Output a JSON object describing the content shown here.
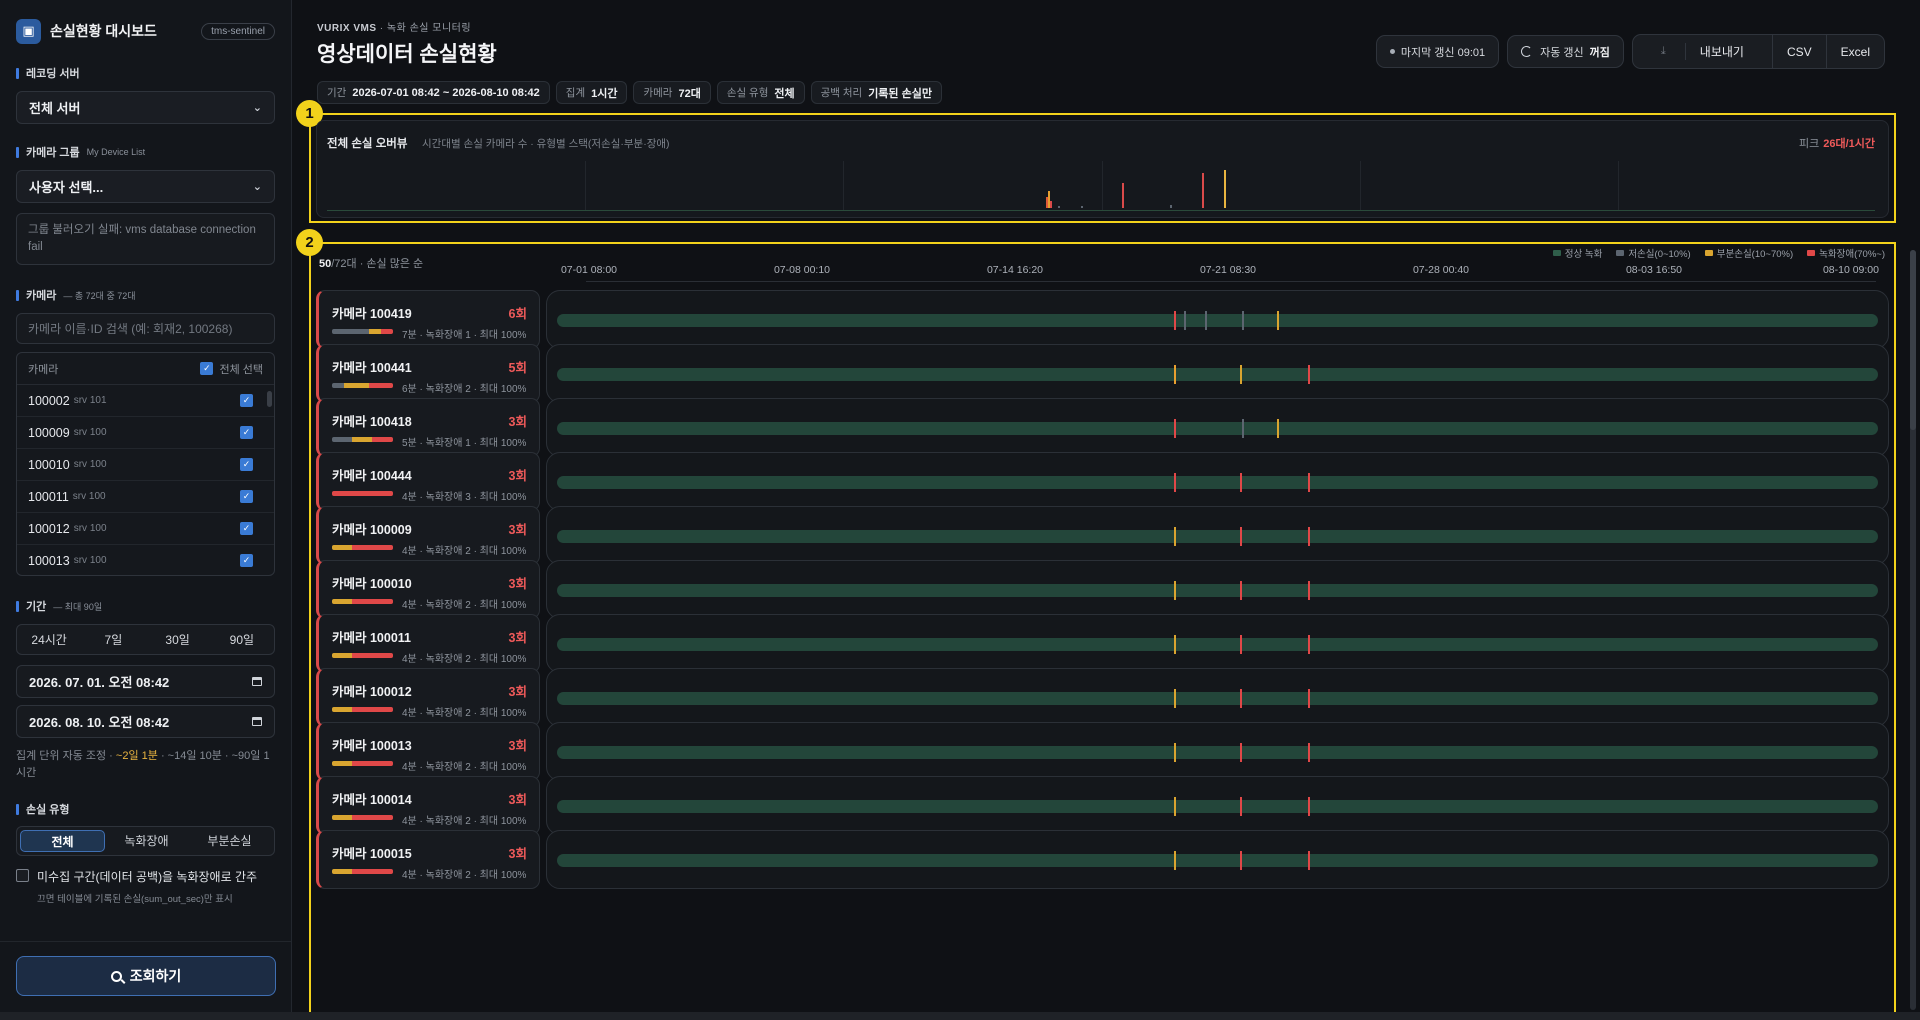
{
  "sidebar": {
    "brand_title": "손실현황 대시보드",
    "brand_badge": "tms-sentinel",
    "brand_icon": "monitor-camera-icon",
    "recording_server_label": "레코딩 서버",
    "recording_server_value": "전체 서버",
    "camera_group_label": "카메라 그룹",
    "camera_group_sub": "My Device List",
    "camera_group_value": "사용자 선택...",
    "group_error": "그룹 불러오기 실패: vms database connection fail",
    "camera_label": "카메라",
    "camera_sub": "— 총 72대 중 72대",
    "camera_search_placeholder": "카메라 이름·ID 검색 (예: 회재2, 100268)",
    "camera_list_header": "카메라",
    "select_all_label": "전체 선택",
    "cameras": [
      {
        "id": "100002",
        "srv": "srv 101"
      },
      {
        "id": "100009",
        "srv": "srv 100"
      },
      {
        "id": "100010",
        "srv": "srv 100"
      },
      {
        "id": "100011",
        "srv": "srv 100"
      },
      {
        "id": "100012",
        "srv": "srv 100"
      },
      {
        "id": "100013",
        "srv": "srv 100"
      }
    ],
    "period_label": "기간",
    "period_sub": "— 최대 90일",
    "period_options": [
      "24시간",
      "7일",
      "30일",
      "90일"
    ],
    "start_datetime": "2026. 07. 01. 오전 08:42",
    "end_datetime": "2026. 08. 10. 오전 08:42",
    "agg_hint_prefix": "집계 단위 자동 조정 ·",
    "agg_hint_highlight": "~2일 1분",
    "agg_hint_rest": "· ~14일 10분 · ~90일 1시간",
    "loss_type_label": "손실 유형",
    "loss_type_options": [
      "전체",
      "녹화장애",
      "부분손실"
    ],
    "loss_type_selected": "전체",
    "gap_checkbox_label": "미수집 구간(데이터 공백)을 녹화장애로 간주",
    "gap_checkbox_sub": "끄면 테이블에 기록된 손실(sum_out_sec)만 표시",
    "query_button": "조회하기"
  },
  "header": {
    "eyebrow_brand": "VURIX VMS",
    "eyebrow_rest": "· 녹화 손실 모니터링",
    "title": "영상데이터 손실현황",
    "last_refresh": "마지막 갱신 09:01",
    "auto_refresh_label": "자동 갱신",
    "auto_refresh_state": "꺼짐",
    "export_label": "내보내기",
    "csv_label": "CSV",
    "excel_label": "Excel"
  },
  "chips": [
    {
      "k": "기간",
      "v": "2026-07-01 08:42 ~ 2026-08-10 08:42"
    },
    {
      "k": "집계",
      "v": "1시간"
    },
    {
      "k": "카메라",
      "v": "72대"
    },
    {
      "k": "손실 유형",
      "v": "전체"
    },
    {
      "k": "공백 처리",
      "v": "기록된 손실만"
    }
  ],
  "annotations": [
    "1",
    "2"
  ],
  "overview": {
    "title": "전체 손실 오버뷰",
    "subtitle": "시간대별 손실 카메라 수 · 유형별 스택(저손실·부분·장애)",
    "peak_label": "피크",
    "peak_value": "26대/1시간",
    "spikes": [
      {
        "t": 0.464,
        "v": 0.22,
        "c": "#e05a3a"
      },
      {
        "t": 0.4655,
        "v": 0.35,
        "c": "#e8a030"
      },
      {
        "t": 0.467,
        "v": 0.15,
        "c": "#d94a4a"
      },
      {
        "t": 0.472,
        "v": 0.05,
        "c": "#5c6570"
      },
      {
        "t": 0.487,
        "v": 0.05,
        "c": "#5c6570"
      },
      {
        "t": 0.513,
        "v": 0.52,
        "c": "#d94a4a"
      },
      {
        "t": 0.544,
        "v": 0.06,
        "c": "#5c6570"
      },
      {
        "t": 0.565,
        "v": 0.72,
        "c": "#d94a4a"
      },
      {
        "t": 0.579,
        "v": 0.8,
        "c": "#e8b440"
      }
    ]
  },
  "timeline": {
    "shown": "50",
    "total_suffix": "/72대 · 손실 많은 순",
    "legend": [
      {
        "label": "정상 녹화",
        "color": "#2f5e4a"
      },
      {
        "label": "저손실(0~10%)",
        "color": "#5c6570"
      },
      {
        "label": "부분손실(10~70%)",
        "color": "#d9a530"
      },
      {
        "label": "녹화장애(70%~)",
        "color": "#e04848"
      }
    ],
    "ticks": [
      "07-01 08:00",
      "07-08 00:10",
      "07-14 16:20",
      "07-21 08:30",
      "07-28 00:40",
      "08-03 16:50",
      "08-10 09:00"
    ],
    "rows": [
      {
        "name": "카메라 100419",
        "count": "6회",
        "meta": "7분 · 녹화장애 1 · 최대 100%",
        "mini": [
          [
            "#5c6570",
            0.6
          ],
          [
            "#d9a530",
            0.2
          ],
          [
            "#e04848",
            0.2
          ]
        ],
        "marks": [
          {
            "t": 0.466,
            "c": "#e04848"
          },
          {
            "t": 0.474,
            "c": "#5c6570"
          },
          {
            "t": 0.49,
            "c": "#5c6570"
          },
          {
            "t": 0.518,
            "c": "#5c6570"
          },
          {
            "t": 0.544,
            "c": "#d9a530"
          }
        ]
      },
      {
        "name": "카메라 100441",
        "count": "5회",
        "meta": "6분 · 녹화장애 2 · 최대 100%",
        "mini": [
          [
            "#5c6570",
            0.2
          ],
          [
            "#d9a530",
            0.4
          ],
          [
            "#e04848",
            0.4
          ]
        ],
        "marks": [
          {
            "t": 0.4665,
            "c": "#e8a030"
          },
          {
            "t": 0.516,
            "c": "#d9a530"
          },
          {
            "t": 0.568,
            "c": "#e04848"
          }
        ]
      },
      {
        "name": "카메라 100418",
        "count": "3회",
        "meta": "5분 · 녹화장애 1 · 최대 100%",
        "mini": [
          [
            "#5c6570",
            0.33
          ],
          [
            "#d9a530",
            0.33
          ],
          [
            "#e04848",
            0.34
          ]
        ],
        "marks": [
          {
            "t": 0.466,
            "c": "#e04848"
          },
          {
            "t": 0.518,
            "c": "#5c6570"
          },
          {
            "t": 0.544,
            "c": "#d9a530"
          }
        ]
      },
      {
        "name": "카메라 100444",
        "count": "3회",
        "meta": "4분 · 녹화장애 3 · 최대 100%",
        "mini": [
          [
            "#e04848",
            1
          ]
        ],
        "marks": [
          {
            "t": 0.4665,
            "c": "#e04848"
          },
          {
            "t": 0.516,
            "c": "#e04848"
          },
          {
            "t": 0.568,
            "c": "#e04848"
          }
        ]
      },
      {
        "name": "카메라 100009",
        "count": "3회",
        "meta": "4분 · 녹화장애 2 · 최대 100%",
        "mini": [
          [
            "#d9a530",
            0.33
          ],
          [
            "#e04848",
            0.67
          ]
        ],
        "marks": [
          {
            "t": 0.4665,
            "c": "#d9a530"
          },
          {
            "t": 0.516,
            "c": "#e04848"
          },
          {
            "t": 0.568,
            "c": "#e04848"
          }
        ]
      },
      {
        "name": "카메라 100010",
        "count": "3회",
        "meta": "4분 · 녹화장애 2 · 최대 100%",
        "mini": [
          [
            "#d9a530",
            0.33
          ],
          [
            "#e04848",
            0.67
          ]
        ],
        "marks": [
          {
            "t": 0.4665,
            "c": "#d9a530"
          },
          {
            "t": 0.516,
            "c": "#e04848"
          },
          {
            "t": 0.568,
            "c": "#e04848"
          }
        ]
      },
      {
        "name": "카메라 100011",
        "count": "3회",
        "meta": "4분 · 녹화장애 2 · 최대 100%",
        "mini": [
          [
            "#d9a530",
            0.33
          ],
          [
            "#e04848",
            0.67
          ]
        ],
        "marks": [
          {
            "t": 0.4665,
            "c": "#d9a530"
          },
          {
            "t": 0.516,
            "c": "#e04848"
          },
          {
            "t": 0.568,
            "c": "#e04848"
          }
        ]
      },
      {
        "name": "카메라 100012",
        "count": "3회",
        "meta": "4분 · 녹화장애 2 · 최대 100%",
        "mini": [
          [
            "#d9a530",
            0.33
          ],
          [
            "#e04848",
            0.67
          ]
        ],
        "marks": [
          {
            "t": 0.4665,
            "c": "#d9a530"
          },
          {
            "t": 0.516,
            "c": "#e04848"
          },
          {
            "t": 0.568,
            "c": "#e04848"
          }
        ]
      },
      {
        "name": "카메라 100013",
        "count": "3회",
        "meta": "4분 · 녹화장애 2 · 최대 100%",
        "mini": [
          [
            "#d9a530",
            0.33
          ],
          [
            "#e04848",
            0.67
          ]
        ],
        "marks": [
          {
            "t": 0.4665,
            "c": "#d9a530"
          },
          {
            "t": 0.516,
            "c": "#e04848"
          },
          {
            "t": 0.568,
            "c": "#e04848"
          }
        ]
      },
      {
        "name": "카메라 100014",
        "count": "3회",
        "meta": "4분 · 녹화장애 2 · 최대 100%",
        "mini": [
          [
            "#d9a530",
            0.33
          ],
          [
            "#e04848",
            0.67
          ]
        ],
        "marks": [
          {
            "t": 0.4665,
            "c": "#d9a530"
          },
          {
            "t": 0.516,
            "c": "#e04848"
          },
          {
            "t": 0.568,
            "c": "#e04848"
          }
        ]
      },
      {
        "name": "카메라 100015",
        "count": "3회",
        "meta": "4분 · 녹화장애 2 · 최대 100%",
        "mini": [
          [
            "#d9a530",
            0.33
          ],
          [
            "#e04848",
            0.67
          ]
        ],
        "marks": [
          {
            "t": 0.4665,
            "c": "#d9a530"
          },
          {
            "t": 0.516,
            "c": "#e04848"
          },
          {
            "t": 0.568,
            "c": "#e04848"
          }
        ]
      }
    ]
  }
}
